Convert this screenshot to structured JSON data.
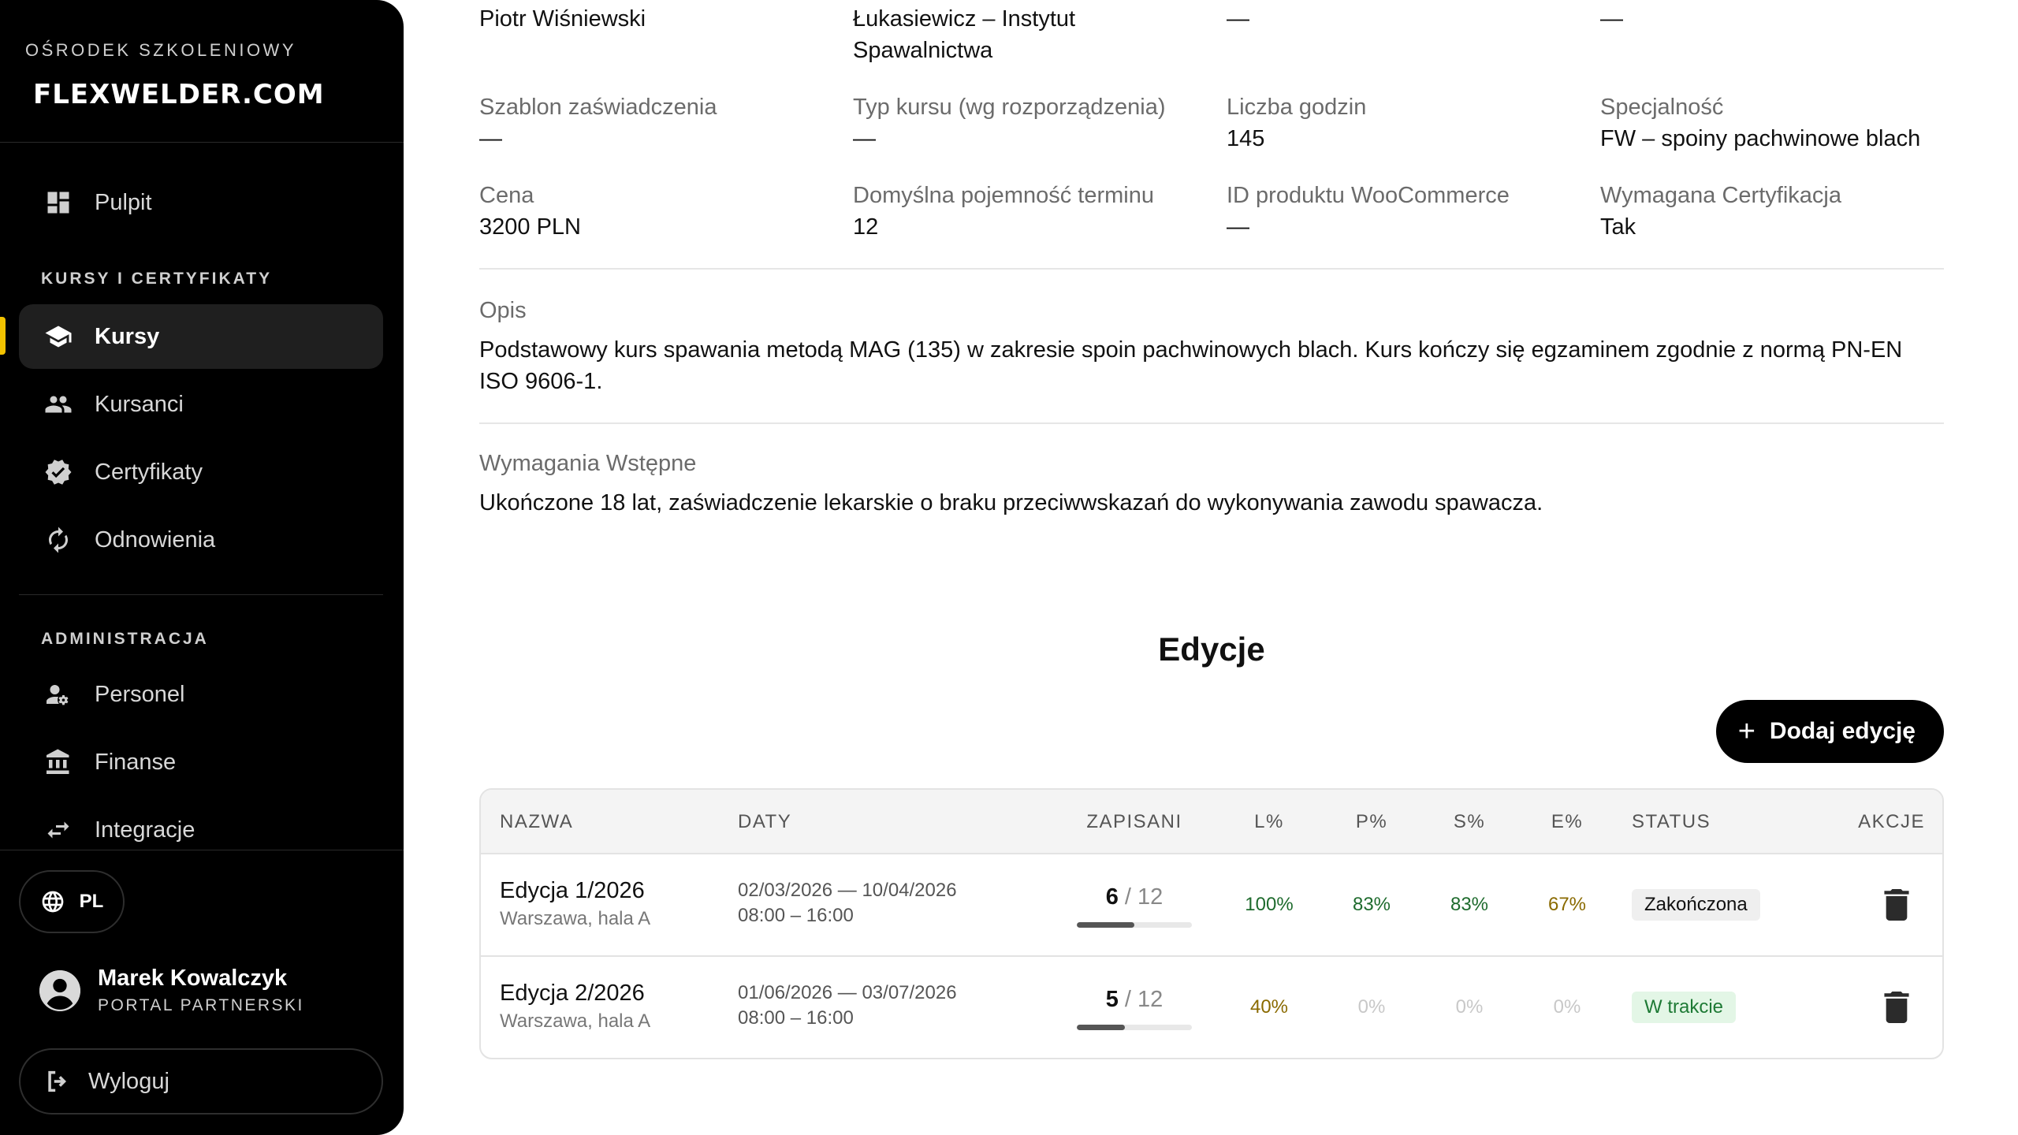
{
  "sidebar": {
    "brand_sub": "OŚRODEK SZKOLENIOWY",
    "brand_name": "FLEXWELDER.COM",
    "dashboard": {
      "label": "Pulpit",
      "icon": "dashboard-icon"
    },
    "section_courses": "KURSY I CERTYFIKATY",
    "items_courses": [
      {
        "label": "Kursy",
        "icon": "graduation-cap-icon",
        "active": true
      },
      {
        "label": "Kursanci",
        "icon": "people-icon"
      },
      {
        "label": "Certyfikaty",
        "icon": "verified-badge-icon"
      },
      {
        "label": "Odnowienia",
        "icon": "refresh-icon"
      }
    ],
    "section_admin": "ADMINISTRACJA",
    "items_admin": [
      {
        "label": "Personel",
        "icon": "staff-settings-icon"
      },
      {
        "label": "Finanse",
        "icon": "bank-icon"
      },
      {
        "label": "Integracje",
        "icon": "swap-arrows-icon"
      }
    ],
    "language": "PL",
    "user": {
      "name": "Marek Kowalczyk",
      "role": "PORTAL PARTNERSKI"
    },
    "logout": "Wyloguj",
    "accent": "#f2c200"
  },
  "course": {
    "row0": {
      "col1": "Piotr Wiśniewski",
      "col2": "Łukasiewicz – Instytut Spawalnictwa",
      "col3": "—",
      "col4": "—"
    },
    "fields": [
      {
        "label": "Szablon zaświadczenia",
        "value": "—"
      },
      {
        "label": "Typ kursu (wg rozporządzenia)",
        "value": "—"
      },
      {
        "label": "Liczba godzin",
        "value": "145"
      },
      {
        "label": "Specjalność",
        "value": "FW – spoiny pachwinowe blach"
      },
      {
        "label": "Cena",
        "value": "3200 PLN"
      },
      {
        "label": "Domyślna pojemność terminu",
        "value": "12"
      },
      {
        "label": "ID produktu WooCommerce",
        "value": "—"
      },
      {
        "label": "Wymagana Certyfikacja",
        "value": "Tak"
      }
    ],
    "description_label": "Opis",
    "description": "Podstawowy kurs spawania metodą MAG (135) w zakresie spoin pachwinowych blach. Kurs kończy się egzaminem zgodnie z normą PN-EN ISO 9606-1.",
    "requirements_label": "Wymagania Wstępne",
    "requirements": "Ukończone 18 lat, zaświadczenie lekarskie o braku przeciwwskazań do wykonywania zawodu spawacza."
  },
  "editions": {
    "title": "Edycje",
    "add_button": "Dodaj edycję",
    "headers": [
      "NAZWA",
      "DATY",
      "ZAPISANI",
      "L%",
      "P%",
      "S%",
      "E%",
      "STATUS",
      "AKCJE"
    ],
    "rows": [
      {
        "name": "Edycja 1/2026",
        "location": "Warszawa, hala A",
        "dates": "02/03/2026 — 10/04/2026",
        "hours": "08:00 – 16:00",
        "enrolled": "6",
        "capacity": "/ 12",
        "fill_fraction": 0.5,
        "l": "100%",
        "p": "83%",
        "s": "83%",
        "e": "67%",
        "status": "Zakończona"
      },
      {
        "name": "Edycja 2/2026",
        "location": "Warszawa, hala A",
        "dates": "01/06/2026 — 03/07/2026",
        "hours": "08:00 – 16:00",
        "enrolled": "5",
        "capacity": "/ 12",
        "fill_fraction": 0.4167,
        "l": "40%",
        "p": "0%",
        "s": "0%",
        "e": "0%",
        "status": "W trakcie"
      }
    ],
    "colors": {
      "green": "#1e6b2d",
      "amber": "#8a6a00",
      "muted": "#c8c8c8"
    }
  }
}
